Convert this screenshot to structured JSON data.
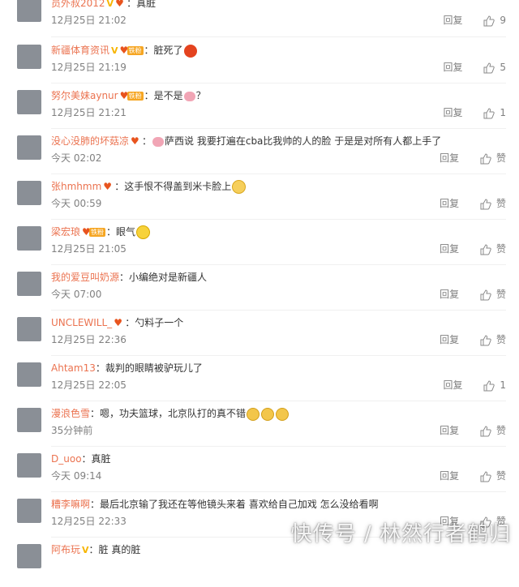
{
  "comments": [
    {
      "user": "员外叔2012",
      "text": "：真脏",
      "time": "12月25日 21:02",
      "reply": "回复",
      "likes": "9",
      "badge_v": "V",
      "fan_tag": ""
    },
    {
      "user": "新疆体育资讯",
      "text": "：脏死了",
      "time": "12月25日 21:19",
      "reply": "回复",
      "likes": "5",
      "badge_v": "V",
      "fan_tag": "铁粉",
      "emoji": "angry-emoji"
    },
    {
      "user": "努尔美妹aynur",
      "text": "：是不是",
      "text_after": "？",
      "time": "12月25日 21:21",
      "reply": "回复",
      "likes": "1",
      "fan_tag": "铁粉",
      "emoji": "pig-emoji"
    },
    {
      "user": "没心没肺的坏菇凉",
      "text": "：",
      "text_after": "萨西说  我要打遍在cba比我帅的人的脸  于是是对所有人都上手了",
      "time": "今天 02:02",
      "reply": "回复",
      "likes": "赞",
      "emoji": "pig-emoji"
    },
    {
      "user": "张hmhmm",
      "text": "：这手恨不得盖到米卡脸上",
      "time": "今天 00:59",
      "reply": "回复",
      "likes": "赞",
      "emoji": "drool-emoji"
    },
    {
      "user": "梁宏琅",
      "text": "：眼气",
      "time": "12月25日 21:05",
      "reply": "回复",
      "likes": "赞",
      "fan_tag": "铁粉",
      "emoji": "smile-emoji"
    },
    {
      "user": "我的爱豆叫奶源",
      "text": "：小编绝对是新疆人",
      "time": "今天 07:00",
      "reply": "回复",
      "likes": "赞"
    },
    {
      "user": "UNCLEWILL_",
      "text": "：勺料子一个",
      "time": "12月25日 22:36",
      "reply": "回复",
      "likes": "赞"
    },
    {
      "user": "Ahtam13",
      "text": "：裁判的眼睛被驴玩儿了",
      "time": "12月25日 22:05",
      "reply": "回复",
      "likes": "1"
    },
    {
      "user": "漫浪色雪",
      "text": "：嗯，功夫篮球，北京队打的真不错",
      "time": "35分钟前",
      "reply": "回复",
      "likes": "赞",
      "emoji": "cry-emoji"
    },
    {
      "user": "D_uoo",
      "text": "：真脏",
      "time": "今天 09:14",
      "reply": "回复",
      "likes": "赞"
    },
    {
      "user": "糟李嘛啊",
      "text": "：最后北京输了我还在等他镜头来着  喜欢给自己加戏  怎么没给看啊",
      "time": "12月25日 22:33",
      "reply": "回复",
      "likes": "赞"
    },
    {
      "user": "阿布玩",
      "text": "：脏  真的脏",
      "time": "",
      "reply": "",
      "likes": "",
      "badge_v": "V"
    }
  ],
  "watermark": "快传号 / 林然行者鹤归",
  "colors": {
    "username": "#eb7350",
    "meta": "#808080",
    "text": "#333333"
  }
}
